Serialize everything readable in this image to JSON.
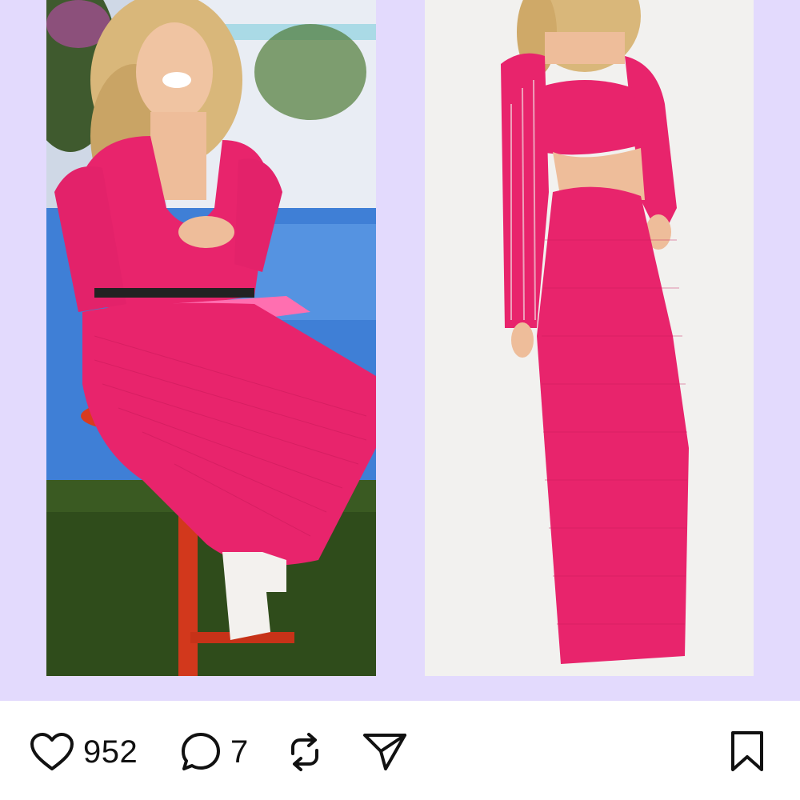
{
  "post": {
    "likes": "952",
    "comments": "7"
  },
  "icons": {
    "like": "heart-icon",
    "comment": "comment-bubble-icon",
    "repost": "repost-arrows-icon",
    "share": "paper-plane-icon",
    "save": "bookmark-icon"
  },
  "colors": {
    "media_background": "#e3dafd",
    "outfit_pink": "#e8246c",
    "icon_color": "#111111"
  }
}
